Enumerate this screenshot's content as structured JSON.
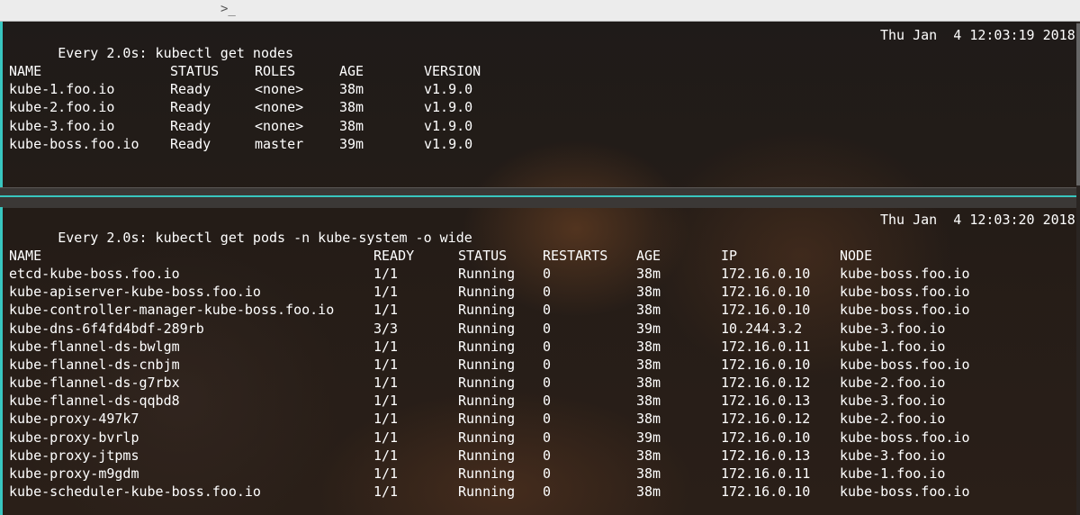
{
  "titlebar": {
    "prompt_icon": ">_"
  },
  "nodes_pane": {
    "command": "Every 2.0s: kubectl get nodes",
    "timestamp": "Thu Jan  4 12:03:19 2018",
    "headers": [
      "NAME",
      "STATUS",
      "ROLES",
      "AGE",
      "VERSION"
    ],
    "rows": [
      [
        "kube-1.foo.io",
        "Ready",
        "<none>",
        "38m",
        "v1.9.0"
      ],
      [
        "kube-2.foo.io",
        "Ready",
        "<none>",
        "38m",
        "v1.9.0"
      ],
      [
        "kube-3.foo.io",
        "Ready",
        "<none>",
        "38m",
        "v1.9.0"
      ],
      [
        "kube-boss.foo.io",
        "Ready",
        "master",
        "39m",
        "v1.9.0"
      ]
    ]
  },
  "pods_pane": {
    "command": "Every 2.0s: kubectl get pods -n kube-system -o wide",
    "timestamp": "Thu Jan  4 12:03:20 2018",
    "headers": [
      "NAME",
      "READY",
      "STATUS",
      "RESTARTS",
      "AGE",
      "IP",
      "NODE"
    ],
    "rows": [
      [
        "etcd-kube-boss.foo.io",
        "1/1",
        "Running",
        "0",
        "38m",
        "172.16.0.10",
        "kube-boss.foo.io"
      ],
      [
        "kube-apiserver-kube-boss.foo.io",
        "1/1",
        "Running",
        "0",
        "38m",
        "172.16.0.10",
        "kube-boss.foo.io"
      ],
      [
        "kube-controller-manager-kube-boss.foo.io",
        "1/1",
        "Running",
        "0",
        "38m",
        "172.16.0.10",
        "kube-boss.foo.io"
      ],
      [
        "kube-dns-6f4fd4bdf-289rb",
        "3/3",
        "Running",
        "0",
        "39m",
        "10.244.3.2",
        "kube-3.foo.io"
      ],
      [
        "kube-flannel-ds-bwlgm",
        "1/1",
        "Running",
        "0",
        "38m",
        "172.16.0.11",
        "kube-1.foo.io"
      ],
      [
        "kube-flannel-ds-cnbjm",
        "1/1",
        "Running",
        "0",
        "38m",
        "172.16.0.10",
        "kube-boss.foo.io"
      ],
      [
        "kube-flannel-ds-g7rbx",
        "1/1",
        "Running",
        "0",
        "38m",
        "172.16.0.12",
        "kube-2.foo.io"
      ],
      [
        "kube-flannel-ds-qqbd8",
        "1/1",
        "Running",
        "0",
        "38m",
        "172.16.0.13",
        "kube-3.foo.io"
      ],
      [
        "kube-proxy-497k7",
        "1/1",
        "Running",
        "0",
        "38m",
        "172.16.0.12",
        "kube-2.foo.io"
      ],
      [
        "kube-proxy-bvrlp",
        "1/1",
        "Running",
        "0",
        "39m",
        "172.16.0.10",
        "kube-boss.foo.io"
      ],
      [
        "kube-proxy-jtpms",
        "1/1",
        "Running",
        "0",
        "38m",
        "172.16.0.13",
        "kube-3.foo.io"
      ],
      [
        "kube-proxy-m9gdm",
        "1/1",
        "Running",
        "0",
        "38m",
        "172.16.0.11",
        "kube-1.foo.io"
      ],
      [
        "kube-scheduler-kube-boss.foo.io",
        "1/1",
        "Running",
        "0",
        "38m",
        "172.16.0.10",
        "kube-boss.foo.io"
      ]
    ]
  },
  "colors": {
    "pane_accent": "#38c6c0",
    "text": "#ffffff",
    "titlebar": "#ececec"
  }
}
